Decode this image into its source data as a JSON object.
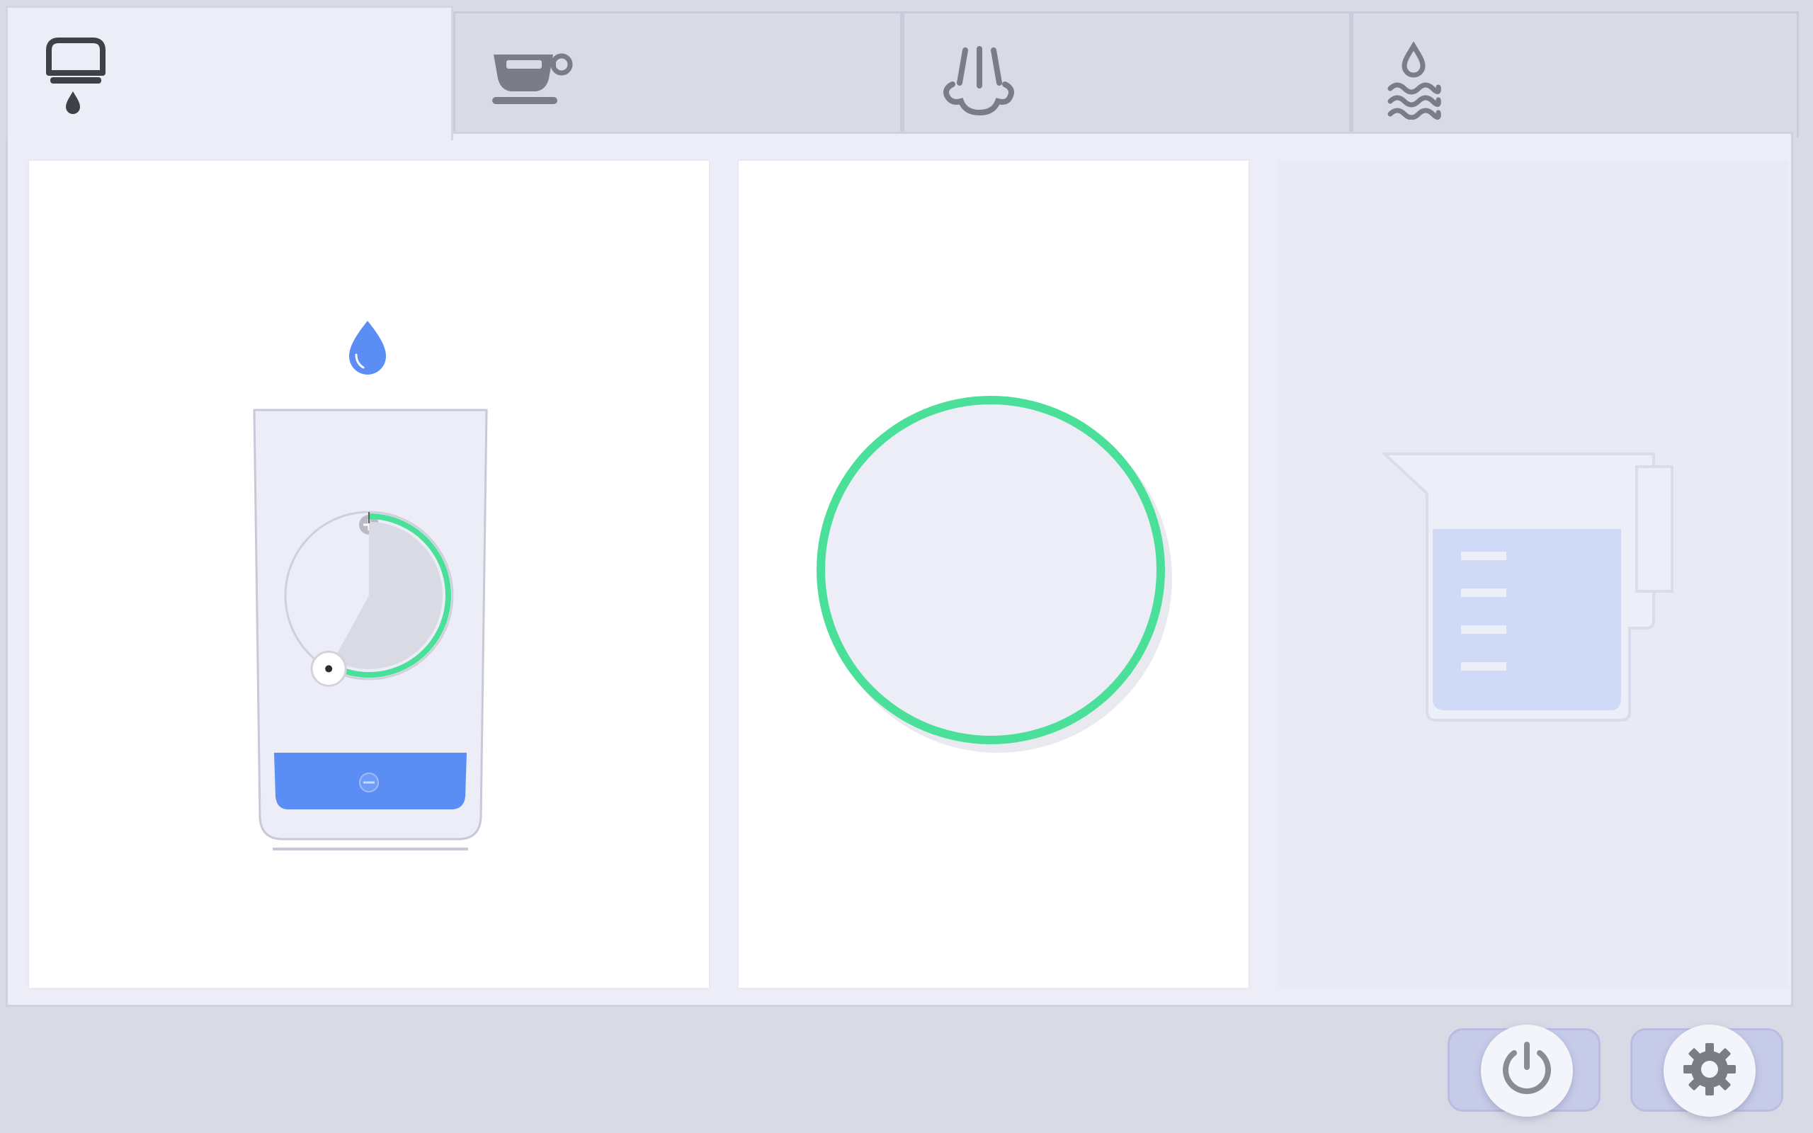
{
  "tabs": [
    {
      "icon": "dispenser-drop-icon",
      "active": true
    },
    {
      "icon": "coffee-cup-icon",
      "active": false
    },
    {
      "icon": "steam-icon",
      "active": false
    },
    {
      "icon": "hot-water-icon",
      "active": false
    }
  ],
  "panels": {
    "glass": {
      "icon": "water-drop-icon",
      "dial_fraction": 0.58,
      "fill_fraction": 0.14,
      "accent": "#4be09a",
      "water_color": "#5b8ef5"
    },
    "start_ring": {
      "accent": "#4be09a"
    },
    "jug": {
      "icon": "measuring-jug-icon",
      "state": "disabled"
    }
  },
  "footer": {
    "power": {
      "icon": "power-icon"
    },
    "settings": {
      "icon": "gear-icon"
    }
  },
  "colors": {
    "background": "#d8dae6",
    "panel": "#ffffff",
    "accent": "#4be09a",
    "water": "#5b8ef5"
  }
}
